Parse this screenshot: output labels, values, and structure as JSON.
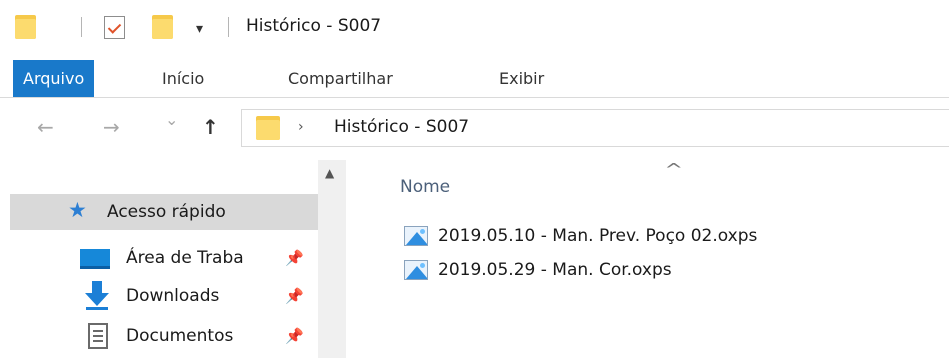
{
  "window": {
    "title": "Histórico - S007"
  },
  "quick_access_toolbar": {
    "icons": [
      "folder-icon",
      "properties-check-icon",
      "new-folder-icon",
      "customize-dropdown-icon"
    ],
    "dropdown_glyph": "▾"
  },
  "ribbon": {
    "tabs": [
      {
        "label": "Arquivo",
        "active": true
      },
      {
        "label": "Início",
        "active": false
      },
      {
        "label": "Compartilhar",
        "active": false
      },
      {
        "label": "Exibir",
        "active": false
      }
    ],
    "active_color": "#1979ca"
  },
  "address_bar": {
    "back_glyph": "←",
    "forward_glyph": "→",
    "recent_glyph": "⌄",
    "up_glyph": "↑",
    "chevron_glyph": "›",
    "path": "Histórico - S007"
  },
  "navigation_pane": {
    "scroll_up_glyph": "▲",
    "pin_glyph": "📌",
    "items": [
      {
        "label": "Acesso rápido",
        "icon": "star-icon",
        "selected": true,
        "pinned": false
      },
      {
        "label": "Área de Traba",
        "icon": "desktop-icon",
        "selected": false,
        "pinned": true
      },
      {
        "label": "Downloads",
        "icon": "downloads-icon",
        "selected": false,
        "pinned": true
      },
      {
        "label": "Documentos",
        "icon": "documents-icon",
        "selected": false,
        "pinned": true
      }
    ]
  },
  "content_pane": {
    "sort_glyph": "^",
    "column_header": "Nome",
    "files": [
      {
        "name": "2019.05.10 - Man. Prev. Poço 02.oxps",
        "icon": "xps-document-icon"
      },
      {
        "name": "2019.05.29 - Man. Cor.oxps",
        "icon": "xps-document-icon"
      }
    ]
  }
}
